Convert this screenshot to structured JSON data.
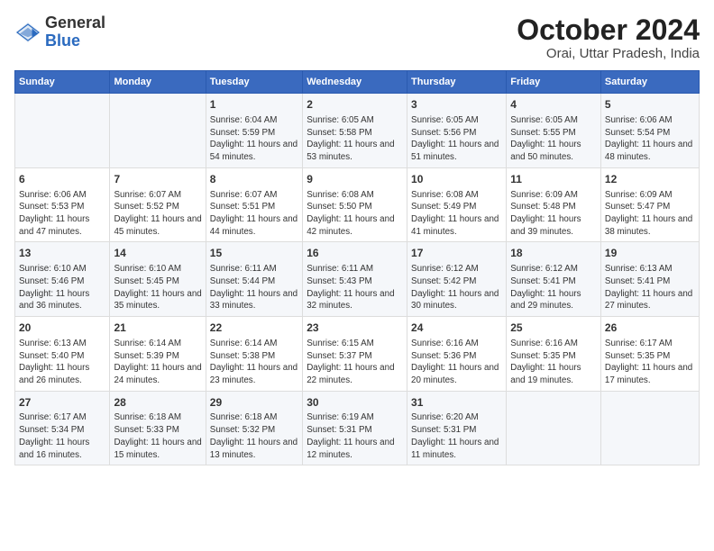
{
  "header": {
    "logo_general": "General",
    "logo_blue": "Blue",
    "title": "October 2024",
    "subtitle": "Orai, Uttar Pradesh, India"
  },
  "days_of_week": [
    "Sunday",
    "Monday",
    "Tuesday",
    "Wednesday",
    "Thursday",
    "Friday",
    "Saturday"
  ],
  "weeks": [
    [
      {
        "day": "",
        "info": ""
      },
      {
        "day": "",
        "info": ""
      },
      {
        "day": "1",
        "info": "Sunrise: 6:04 AM\nSunset: 5:59 PM\nDaylight: 11 hours and 54 minutes."
      },
      {
        "day": "2",
        "info": "Sunrise: 6:05 AM\nSunset: 5:58 PM\nDaylight: 11 hours and 53 minutes."
      },
      {
        "day": "3",
        "info": "Sunrise: 6:05 AM\nSunset: 5:56 PM\nDaylight: 11 hours and 51 minutes."
      },
      {
        "day": "4",
        "info": "Sunrise: 6:05 AM\nSunset: 5:55 PM\nDaylight: 11 hours and 50 minutes."
      },
      {
        "day": "5",
        "info": "Sunrise: 6:06 AM\nSunset: 5:54 PM\nDaylight: 11 hours and 48 minutes."
      }
    ],
    [
      {
        "day": "6",
        "info": "Sunrise: 6:06 AM\nSunset: 5:53 PM\nDaylight: 11 hours and 47 minutes."
      },
      {
        "day": "7",
        "info": "Sunrise: 6:07 AM\nSunset: 5:52 PM\nDaylight: 11 hours and 45 minutes."
      },
      {
        "day": "8",
        "info": "Sunrise: 6:07 AM\nSunset: 5:51 PM\nDaylight: 11 hours and 44 minutes."
      },
      {
        "day": "9",
        "info": "Sunrise: 6:08 AM\nSunset: 5:50 PM\nDaylight: 11 hours and 42 minutes."
      },
      {
        "day": "10",
        "info": "Sunrise: 6:08 AM\nSunset: 5:49 PM\nDaylight: 11 hours and 41 minutes."
      },
      {
        "day": "11",
        "info": "Sunrise: 6:09 AM\nSunset: 5:48 PM\nDaylight: 11 hours and 39 minutes."
      },
      {
        "day": "12",
        "info": "Sunrise: 6:09 AM\nSunset: 5:47 PM\nDaylight: 11 hours and 38 minutes."
      }
    ],
    [
      {
        "day": "13",
        "info": "Sunrise: 6:10 AM\nSunset: 5:46 PM\nDaylight: 11 hours and 36 minutes."
      },
      {
        "day": "14",
        "info": "Sunrise: 6:10 AM\nSunset: 5:45 PM\nDaylight: 11 hours and 35 minutes."
      },
      {
        "day": "15",
        "info": "Sunrise: 6:11 AM\nSunset: 5:44 PM\nDaylight: 11 hours and 33 minutes."
      },
      {
        "day": "16",
        "info": "Sunrise: 6:11 AM\nSunset: 5:43 PM\nDaylight: 11 hours and 32 minutes."
      },
      {
        "day": "17",
        "info": "Sunrise: 6:12 AM\nSunset: 5:42 PM\nDaylight: 11 hours and 30 minutes."
      },
      {
        "day": "18",
        "info": "Sunrise: 6:12 AM\nSunset: 5:41 PM\nDaylight: 11 hours and 29 minutes."
      },
      {
        "day": "19",
        "info": "Sunrise: 6:13 AM\nSunset: 5:41 PM\nDaylight: 11 hours and 27 minutes."
      }
    ],
    [
      {
        "day": "20",
        "info": "Sunrise: 6:13 AM\nSunset: 5:40 PM\nDaylight: 11 hours and 26 minutes."
      },
      {
        "day": "21",
        "info": "Sunrise: 6:14 AM\nSunset: 5:39 PM\nDaylight: 11 hours and 24 minutes."
      },
      {
        "day": "22",
        "info": "Sunrise: 6:14 AM\nSunset: 5:38 PM\nDaylight: 11 hours and 23 minutes."
      },
      {
        "day": "23",
        "info": "Sunrise: 6:15 AM\nSunset: 5:37 PM\nDaylight: 11 hours and 22 minutes."
      },
      {
        "day": "24",
        "info": "Sunrise: 6:16 AM\nSunset: 5:36 PM\nDaylight: 11 hours and 20 minutes."
      },
      {
        "day": "25",
        "info": "Sunrise: 6:16 AM\nSunset: 5:35 PM\nDaylight: 11 hours and 19 minutes."
      },
      {
        "day": "26",
        "info": "Sunrise: 6:17 AM\nSunset: 5:35 PM\nDaylight: 11 hours and 17 minutes."
      }
    ],
    [
      {
        "day": "27",
        "info": "Sunrise: 6:17 AM\nSunset: 5:34 PM\nDaylight: 11 hours and 16 minutes."
      },
      {
        "day": "28",
        "info": "Sunrise: 6:18 AM\nSunset: 5:33 PM\nDaylight: 11 hours and 15 minutes."
      },
      {
        "day": "29",
        "info": "Sunrise: 6:18 AM\nSunset: 5:32 PM\nDaylight: 11 hours and 13 minutes."
      },
      {
        "day": "30",
        "info": "Sunrise: 6:19 AM\nSunset: 5:31 PM\nDaylight: 11 hours and 12 minutes."
      },
      {
        "day": "31",
        "info": "Sunrise: 6:20 AM\nSunset: 5:31 PM\nDaylight: 11 hours and 11 minutes."
      },
      {
        "day": "",
        "info": ""
      },
      {
        "day": "",
        "info": ""
      }
    ]
  ]
}
